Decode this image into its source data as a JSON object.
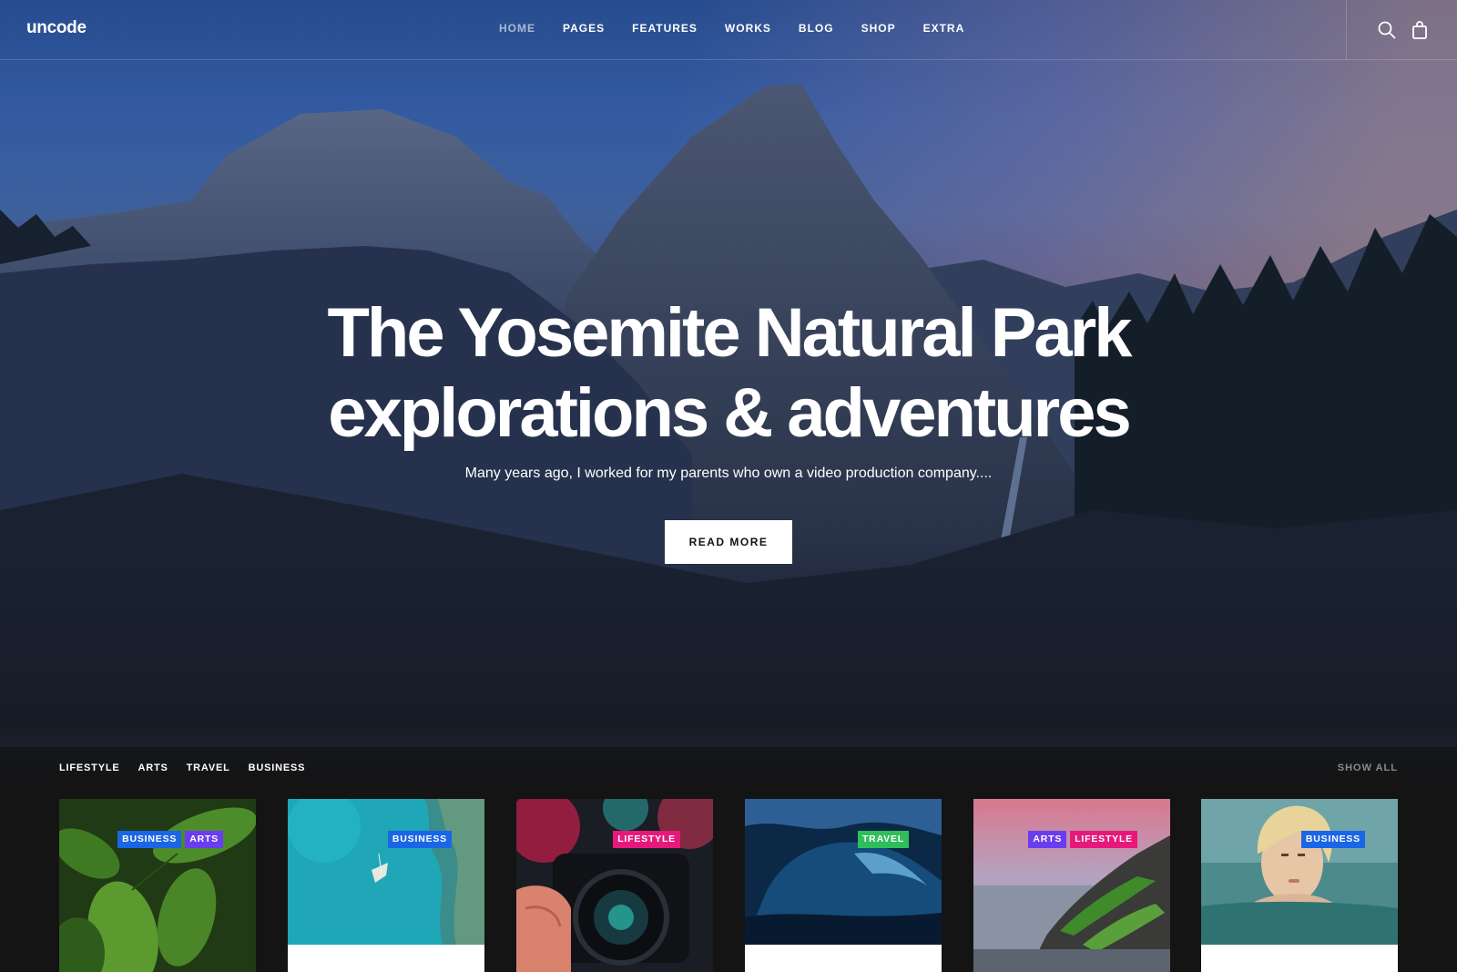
{
  "header": {
    "logo": "uncode",
    "nav": [
      {
        "label": "HOME",
        "active": true
      },
      {
        "label": "PAGES",
        "active": false
      },
      {
        "label": "FEATURES",
        "active": false
      },
      {
        "label": "WORKS",
        "active": false
      },
      {
        "label": "BLOG",
        "active": false
      },
      {
        "label": "SHOP",
        "active": false
      },
      {
        "label": "EXTRA",
        "active": false
      }
    ],
    "icons": [
      "search-icon",
      "shopping-bag-icon"
    ]
  },
  "hero": {
    "title_line1": "The Yosemite Natural Park",
    "title_line2": "explorations & adventures",
    "subtitle": "Many years ago, I worked for my parents who own a video production company....",
    "button": "READ MORE"
  },
  "filters": {
    "items": [
      "LIFESTYLE",
      "ARTS",
      "TRAVEL",
      "BUSINESS"
    ],
    "show_all": "SHOW ALL"
  },
  "tag_colors": {
    "BUSINESS": "#1a66e6",
    "ARTS": "#6a3df0",
    "LIFESTYLE": "#e6197a",
    "TRAVEL": "#2fbf5a"
  },
  "cards": [
    {
      "tags": [
        "BUSINESS",
        "ARTS"
      ],
      "image": "green-leaves"
    },
    {
      "tags": [
        "BUSINESS"
      ],
      "image": "aerial-boat-turquoise-sea"
    },
    {
      "tags": [
        "LIFESTYLE"
      ],
      "image": "hand-holding-camera"
    },
    {
      "tags": [
        "TRAVEL"
      ],
      "image": "ocean-wave"
    },
    {
      "tags": [
        "ARTS",
        "LIFESTYLE"
      ],
      "image": "mossy-rock-beach-sunset"
    },
    {
      "tags": [
        "BUSINESS"
      ],
      "image": "woman-in-water"
    }
  ]
}
